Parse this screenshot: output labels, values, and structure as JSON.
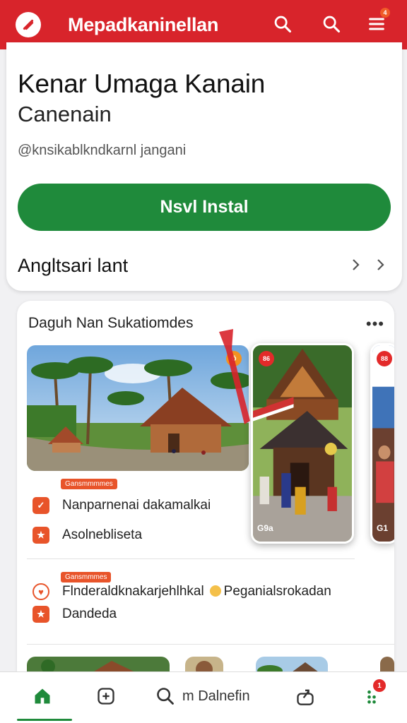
{
  "header": {
    "title": "Mepadkaninellan",
    "notification_badge": "4",
    "icons": [
      "logo-icon",
      "search-icon",
      "search-icon-secondary",
      "menu-icon"
    ]
  },
  "app": {
    "name": "Kenar Umaga  Kanain",
    "subtitle": "Canenain",
    "developer": "@knsikablkndkarnl jangani",
    "install_label": "Nsvl Instal",
    "info_row_label": "Angltsari lant"
  },
  "section": {
    "title": "Daguh Nan Sukatiomdes",
    "more_label": "•••",
    "screenshot_badge_1": "Ö",
    "screenshot_badge_2": "86",
    "screenshot_badge_3": "88",
    "screenshot_caption_2": "G9a",
    "screenshot_caption_3": "G1",
    "tag_1": "Gansmmmmes",
    "tag_2": "Gansmmmes",
    "features": [
      {
        "icon": "check-icon",
        "text": "Nanparnenai dakamalkai"
      },
      {
        "icon": "star-icon",
        "text": "Asolnebliseta"
      },
      {
        "icon": "heart-icon",
        "text": "Flnderaldknakarjehlhkal"
      },
      {
        "icon": "star-icon",
        "text": "Dandeda"
      }
    ],
    "feature_3_suffix": "Peganialsrokadan"
  },
  "bottom_nav": {
    "home": "home-icon",
    "add": "add-icon",
    "search_label": "m Dalnefin",
    "share": "share-icon",
    "apps": "apps-icon",
    "apps_badge": "1"
  },
  "colors": {
    "brand_red": "#d8242b",
    "install_green": "#1f8a3b",
    "accent_orange": "#e8542a"
  }
}
